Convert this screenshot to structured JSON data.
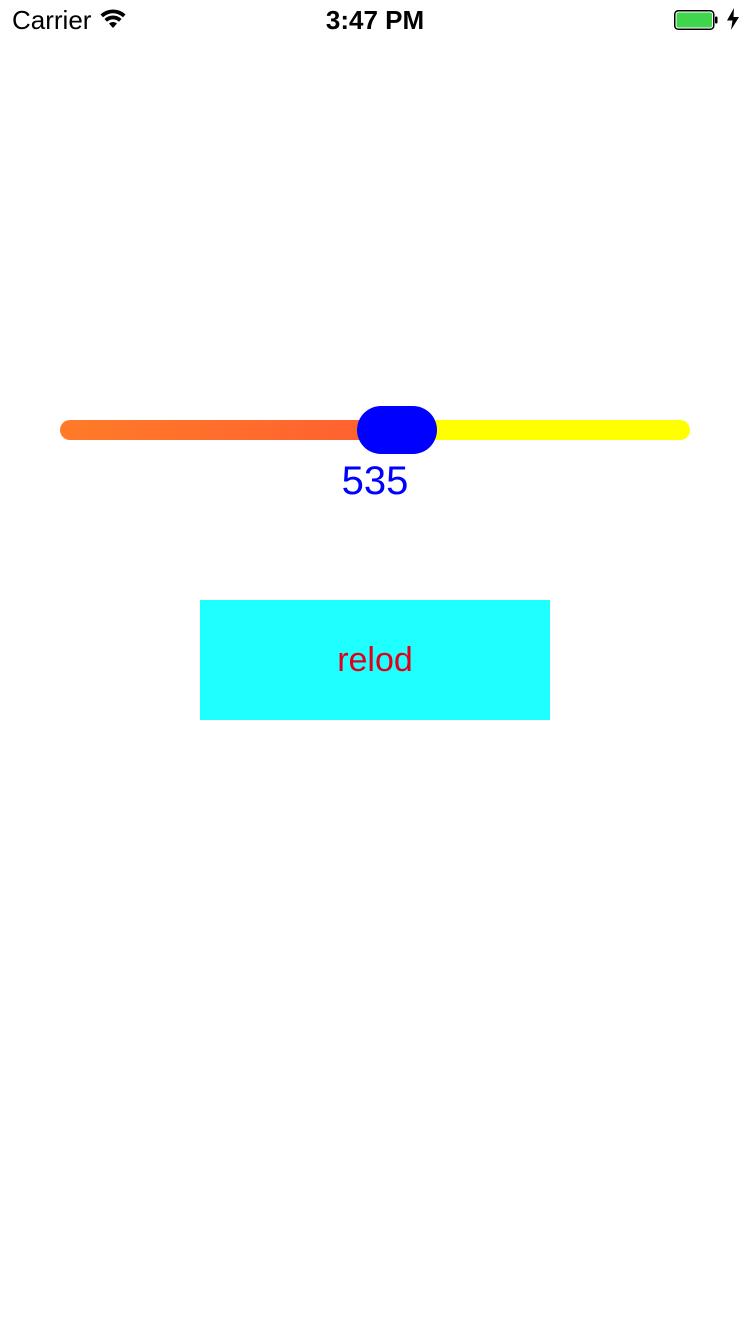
{
  "status_bar": {
    "carrier": "Carrier",
    "time": "3:47 PM",
    "wifi_icon": "wifi-icon",
    "battery_icon": "battery-charging-icon",
    "battery_color": "#3fd54c"
  },
  "slider": {
    "value_fraction": 0.54,
    "min_track_colors": [
      "#ff7b28",
      "#ff5f30"
    ],
    "max_track_color": "#ffff00",
    "thumb_color": "#0000ff"
  },
  "value_label": {
    "text": "535",
    "color": "#0000ff"
  },
  "reload_button": {
    "label": "relod",
    "background": "#1effff",
    "text_color": "#e0001a"
  }
}
